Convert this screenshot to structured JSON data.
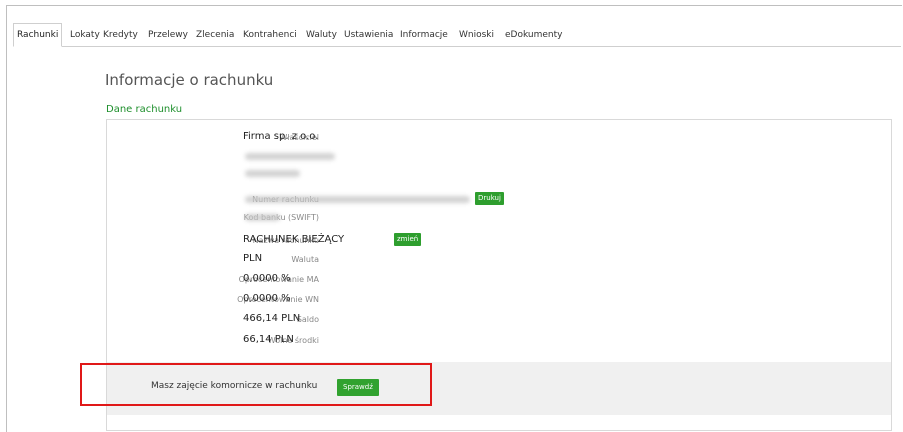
{
  "tabs": [
    "Rachunki",
    "Lokaty",
    "Kredyty",
    "Przelewy",
    "Zlecenia",
    "Kontrahenci",
    "Waluty",
    "Ustawienia",
    "Informacje",
    "Wnioski",
    "eDokumenty"
  ],
  "page_title": "Informacje o rachunku",
  "section_title": "Dane rachunku",
  "fields": {
    "owner_label": "Właściciel",
    "owner_value": "Firma sp. z o.o.",
    "account_number_label": "Numer rachunku",
    "print_button": "Drukuj",
    "bank_code_label": "Kod banku (SWIFT)",
    "account_name_label": "Nazwa rachunku",
    "account_name_value": "RACHUNEK BIEŻĄCY",
    "change_button": "zmień",
    "currency_label": "Waluta",
    "currency_value": "PLN",
    "interest_ma_label": "Oprocentowanie MA",
    "interest_ma_value": "0,0000 %",
    "interest_wn_label": "Oprocentowanie WN",
    "interest_wn_value": "0,0000 %",
    "balance_label": "Saldo",
    "balance_value": "466,14 PLN",
    "available_label": "Wolne środki",
    "available_value": "66,14 PLN"
  },
  "notice": {
    "text": "Masz zajęcie komornicze w rachunku",
    "button": "Sprawdź"
  },
  "colors": {
    "accent_green": "#2e9e2e",
    "highlight_red": "#e01818"
  }
}
